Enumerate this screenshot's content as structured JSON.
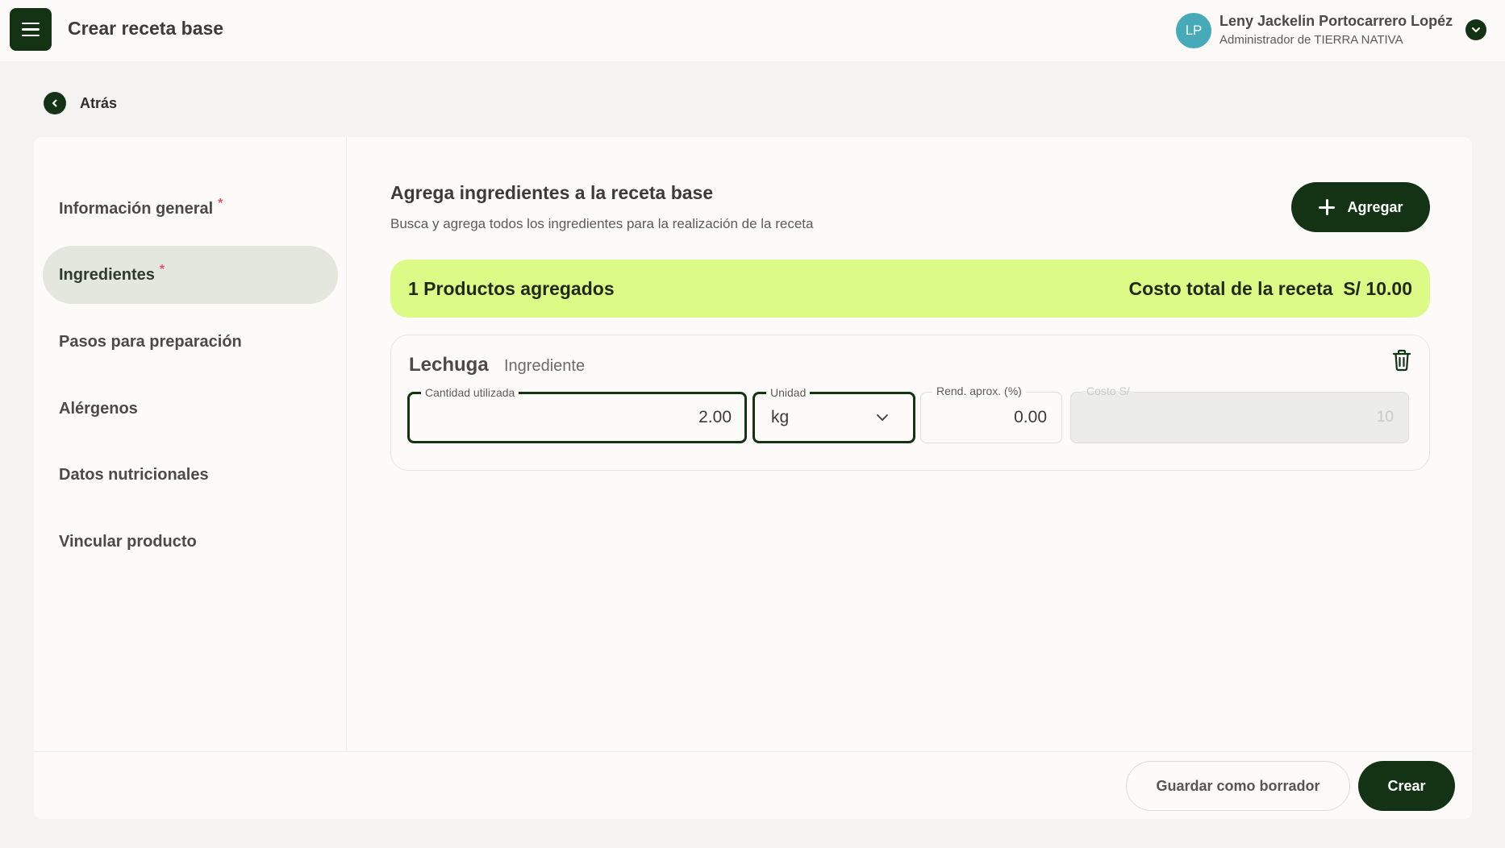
{
  "header": {
    "title": "Crear receta base",
    "user": {
      "initials": "LP",
      "name": "Leny Jackelin Portocarrero Lopéz",
      "role": "Administrador de TIERRA NATIVA"
    }
  },
  "back": {
    "label": "Atrás"
  },
  "sidebar": {
    "items": [
      {
        "label": "Información general",
        "required": "*"
      },
      {
        "label": "Ingredientes",
        "required": "*"
      },
      {
        "label": "Pasos para preparación"
      },
      {
        "label": "Alérgenos"
      },
      {
        "label": "Datos nutricionales"
      },
      {
        "label": "Vincular producto"
      }
    ],
    "active_index": 1
  },
  "main": {
    "title": "Agrega ingredientes a la receta base",
    "subtitle": "Busca y agrega todos los ingredientes para la realización de la receta",
    "add_label": "Agregar",
    "summary": {
      "count_text": "1 Productos agregados",
      "total_label": "Costo total de la receta",
      "total_value": "S/ 10.00"
    },
    "ingredient": {
      "name": "Lechuga",
      "type": "Ingrediente",
      "fields": {
        "quantity": {
          "label": "Cantidad utilizada",
          "value": "2.00"
        },
        "unit": {
          "label": "Unidad",
          "value": "kg"
        },
        "yield": {
          "label": "Rend. aprox. (%)",
          "value": "0.00"
        },
        "cost": {
          "label": "Costo S/",
          "value": "10"
        }
      }
    }
  },
  "footer": {
    "draft_label": "Guardar como borrador",
    "create_label": "Crear"
  },
  "colors": {
    "primary": "#143214",
    "summary_bg": "#dcfb86",
    "active_nav_bg": "#e4e7de",
    "avatar": "#46aab8",
    "required": "#e0556b"
  }
}
